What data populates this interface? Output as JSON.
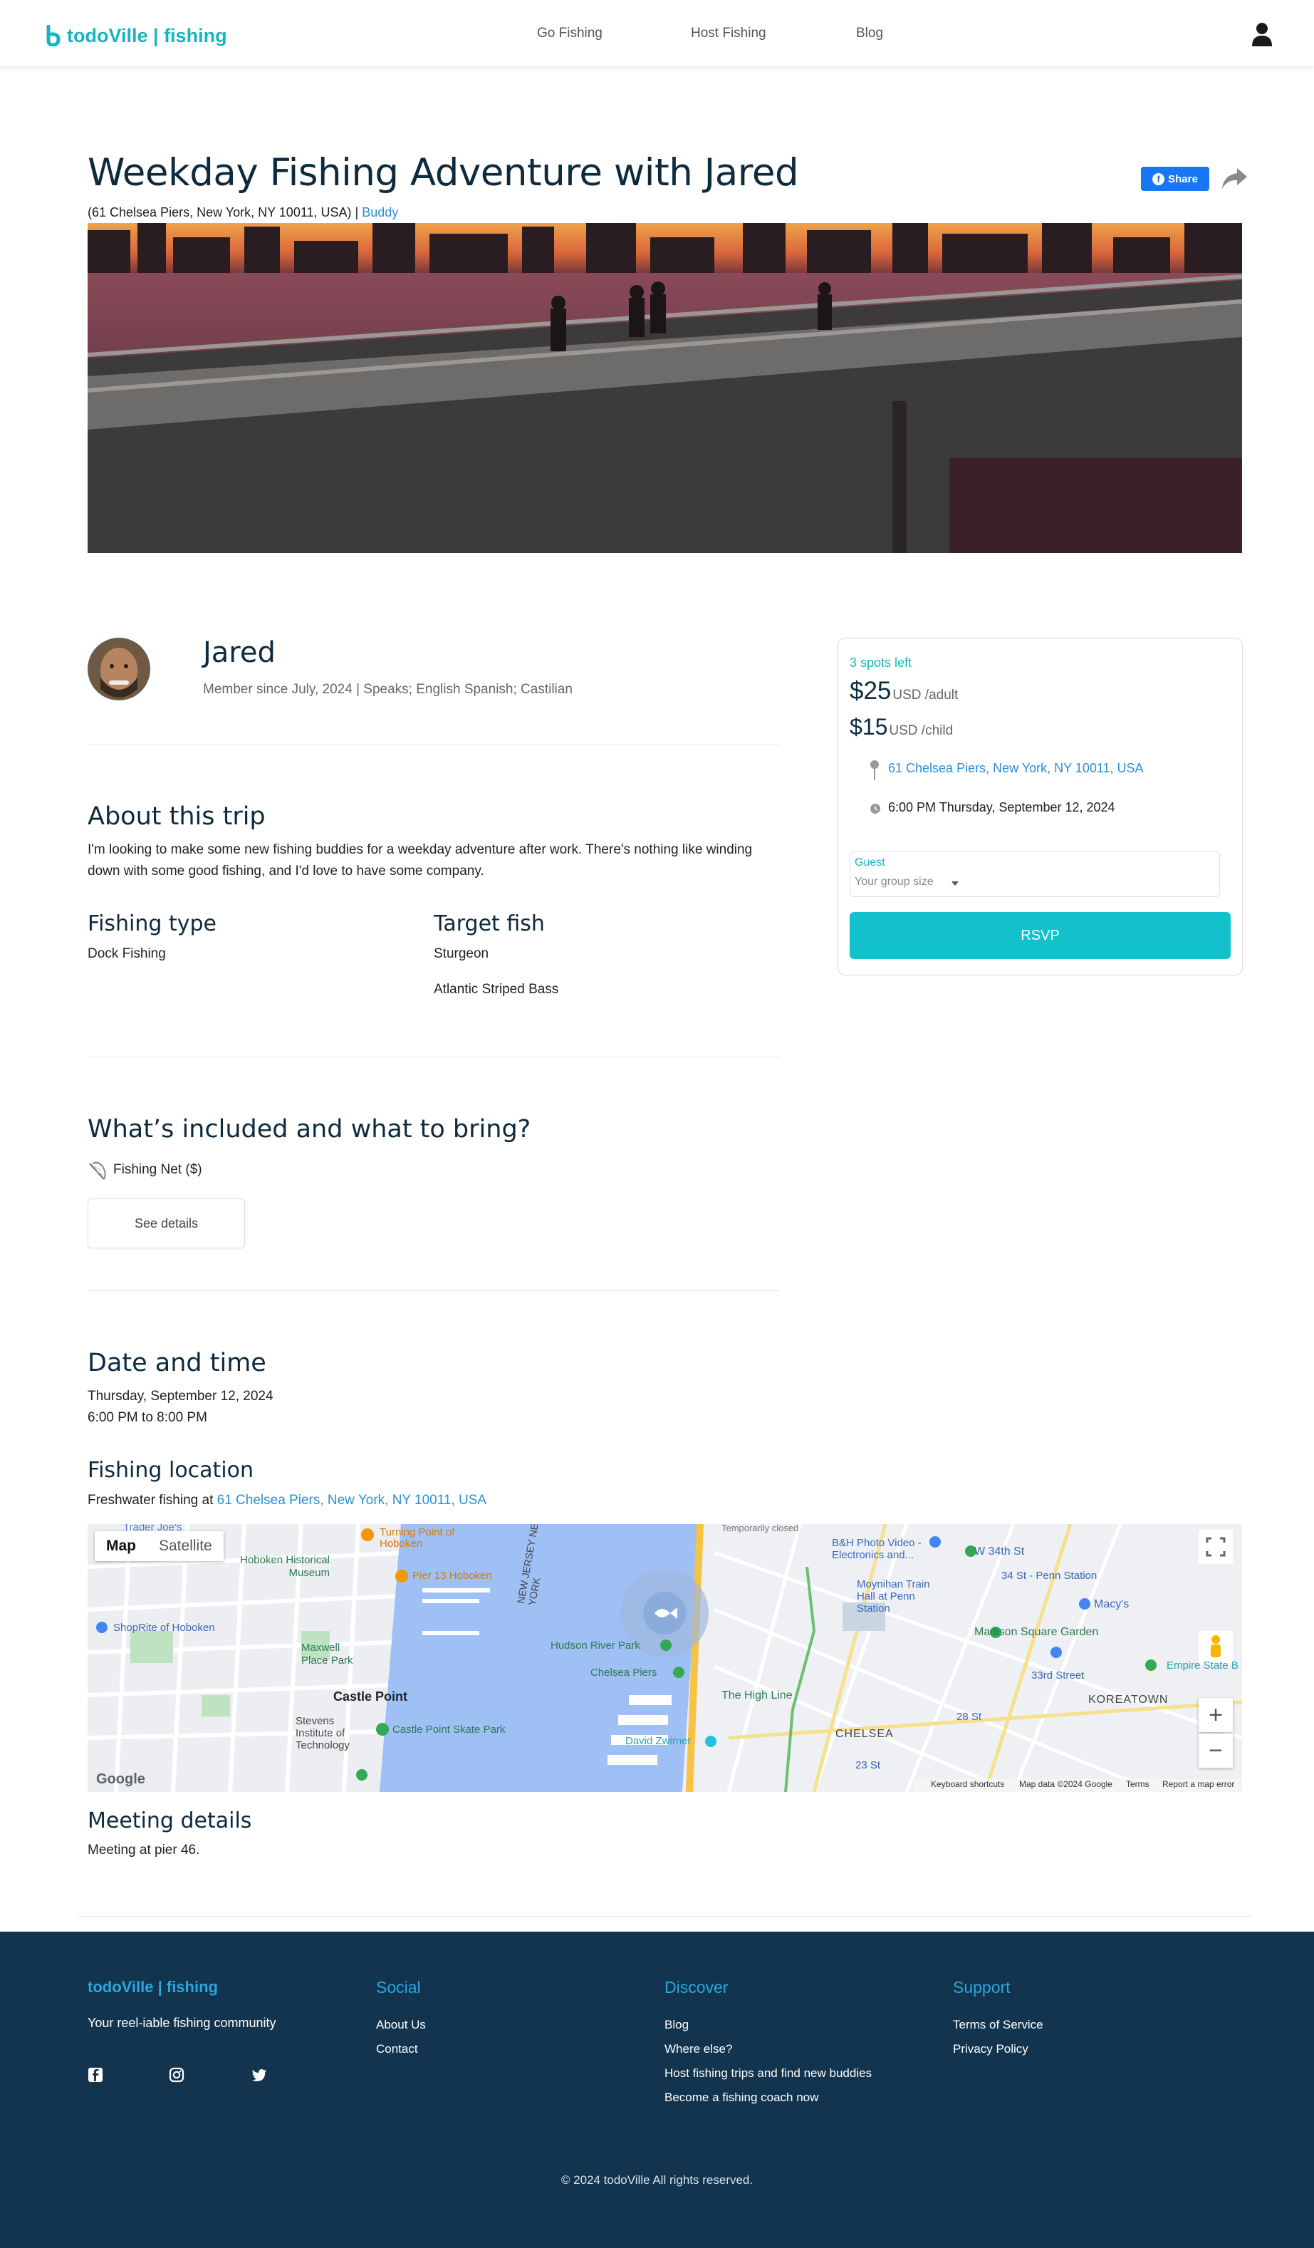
{
  "header": {
    "logo_text": "todoVille | fishing",
    "nav": [
      "Go Fishing",
      "Host Fishing",
      "Blog"
    ]
  },
  "trip": {
    "title": "Weekday Fishing Adventure with Jared",
    "address_paren": "(61 Chelsea Piers, New York, NY 10011, USA)",
    "separator": " | ",
    "category": "Buddy",
    "share_label": "Share"
  },
  "host": {
    "name": "Jared",
    "meta": "Member since July, 2024 | Speaks; English Spanish; Castilian"
  },
  "about": {
    "heading": "About this trip",
    "text": "I'm looking to make some new fishing buddies for a weekday adventure after work. There's nothing like winding down with some good fishing, and I'd love to have some company."
  },
  "fishing_type": {
    "heading": "Fishing type",
    "value": "Dock Fishing"
  },
  "target_fish": {
    "heading": "Target fish",
    "items": [
      "Sturgeon",
      "Atlantic Striped Bass"
    ]
  },
  "included": {
    "heading": "What’s included and what to bring?",
    "items": [
      "Fishing Net ($)"
    ],
    "details_button": "See details"
  },
  "date_time": {
    "heading": "Date and time",
    "date": "Thursday, September 12, 2024",
    "time": "6:00 PM to 8:00 PM"
  },
  "location": {
    "heading": "Fishing location",
    "prefix": "Freshwater fishing at ",
    "address": "61 Chelsea Piers, New York, NY 10011, USA"
  },
  "map": {
    "tabs": [
      "Map",
      "Satellite"
    ],
    "labels": {
      "turning_point": "Turning Point of Hoboken",
      "pier13": "Pier 13 Hoboken",
      "hoboken_museum": "Hoboken Historical Museum",
      "shoprite": "ShopRite of Hoboken",
      "maxwell": "Maxwell Place Park",
      "castle_point": "Castle Point",
      "stevens": "Stevens Institute of Technology",
      "skate_park": "Castle Point Skate Park",
      "nj_ny": "NEW JERSEY NEW YORK",
      "hudson_park": "Hudson River Park",
      "chelsea_piers": "Chelsea Piers",
      "high_line": "The High Line",
      "david_zwirner": "David Zwirner",
      "chelsea": "CHELSEA",
      "koreatown": "KOREATOWN",
      "bh_photo": "B&H Photo Video - Electronics and...",
      "w34": "W 34th St",
      "penn_station": "34 St - Penn Station",
      "moynihan": "Moynihan Train Hall at Penn Station",
      "macys": "Macy's",
      "msg": "Madison Square Garden",
      "street33": "33rd Street",
      "empire": "Empire State B",
      "st28": "28 St",
      "st23": "23 St",
      "temp_closed": "Temporarily closed",
      "trader_joes": "Trader Joe's",
      "google": "Google",
      "attribution": [
        "Keyboard shortcuts",
        "Map data ©2024 Google",
        "Terms",
        "Report a map error"
      ]
    }
  },
  "meeting": {
    "heading": "Meeting details",
    "text": "Meeting at pier 46."
  },
  "booking": {
    "spots": "3 spots left",
    "adult_price": "$25",
    "adult_unit": "USD /adult",
    "child_price": "$15",
    "child_unit": "USD /child",
    "address": "61 Chelsea Piers, New York, NY 10011, USA",
    "datetime": "6:00 PM Thursday, September 12, 2024",
    "guest_label": "Guest",
    "guest_placeholder": "Your group size",
    "rsvp": "RSVP"
  },
  "footer": {
    "brand": "todoVille | fishing",
    "tagline": "Your reel-iable fishing community",
    "social_heading": "Social",
    "social_links": [
      "About Us",
      "Contact"
    ],
    "discover_heading": "Discover",
    "discover_links": [
      "Blog",
      "Where else?",
      "Host fishing trips and find new buddies",
      "Become a fishing coach now"
    ],
    "support_heading": "Support",
    "support_links": [
      "Terms of Service",
      "Privacy Policy"
    ],
    "copyright": "© 2024 todoVille All rights reserved."
  },
  "colors": {
    "accent": "#13c1cc",
    "link": "#2b8fd6",
    "heading": "#0e2a3e",
    "footer_bg": "#12344e"
  }
}
